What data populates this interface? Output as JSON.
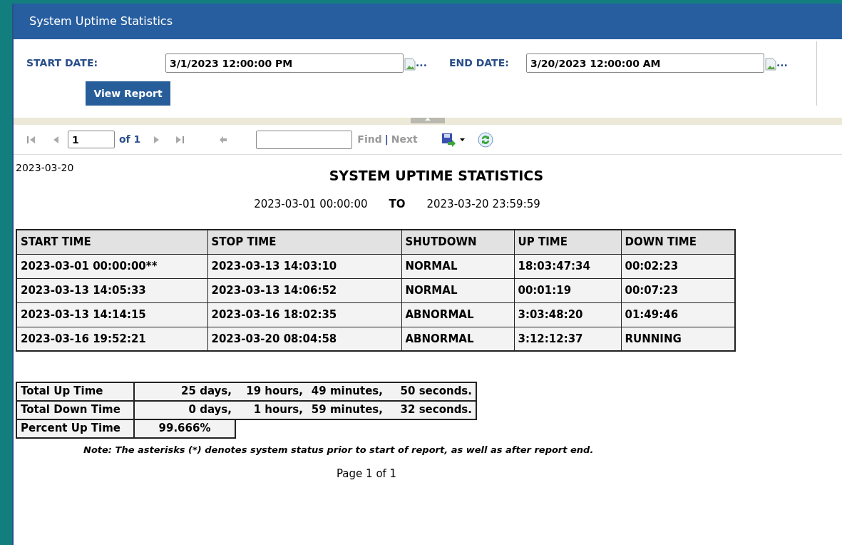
{
  "window": {
    "title": "System Uptime Statistics"
  },
  "parameters": {
    "start_date": {
      "label": "START DATE:",
      "value": "3/1/2023 12:00:00 PM",
      "picker": "..."
    },
    "end_date": {
      "label": "END DATE:",
      "value": "3/20/2023 12:00:00 AM",
      "picker": "..."
    },
    "view_button": "View Report"
  },
  "toolbar": {
    "page": "1",
    "of": "of 1",
    "find_label": "Find",
    "separator": "|",
    "next_label": "Next"
  },
  "report": {
    "date": "2023-03-20",
    "title": "SYSTEM UPTIME STATISTICS",
    "range_from": "2023-03-01 00:00:00",
    "range_to_label": "TO",
    "range_to": "2023-03-20 23:59:59",
    "table": {
      "columns": [
        "START TIME",
        "STOP TIME",
        "SHUTDOWN",
        "UP TIME",
        "DOWN TIME"
      ],
      "rows": [
        [
          "2023-03-01 00:00:00**",
          "2023-03-13 14:03:10",
          "NORMAL",
          "18:03:47:34",
          "00:02:23"
        ],
        [
          "2023-03-13 14:05:33",
          "2023-03-13 14:06:52",
          "NORMAL",
          "00:01:19",
          "00:07:23"
        ],
        [
          "2023-03-13 14:14:15",
          "2023-03-16 18:02:35",
          "ABNORMAL",
          "3:03:48:20",
          "01:49:46"
        ],
        [
          "2023-03-16 19:52:21",
          "2023-03-20 08:04:58",
          "ABNORMAL",
          "3:12:12:37",
          "RUNNING"
        ]
      ]
    },
    "summary": [
      {
        "label": "Total Up Time",
        "values": [
          "25 days,",
          "19 hours,",
          "49 minutes,",
          "50 seconds."
        ]
      },
      {
        "label": "Total Down Time",
        "values": [
          "0 days,",
          "1 hours,",
          "59 minutes,",
          "32 seconds."
        ]
      },
      {
        "label": "Percent Up Time",
        "values": [
          "99.666%"
        ]
      }
    ],
    "note": "Note: The asterisks (*) denotes system status prior to start of report, as well as after report end.",
    "page_footer": "Page 1 of 1"
  }
}
